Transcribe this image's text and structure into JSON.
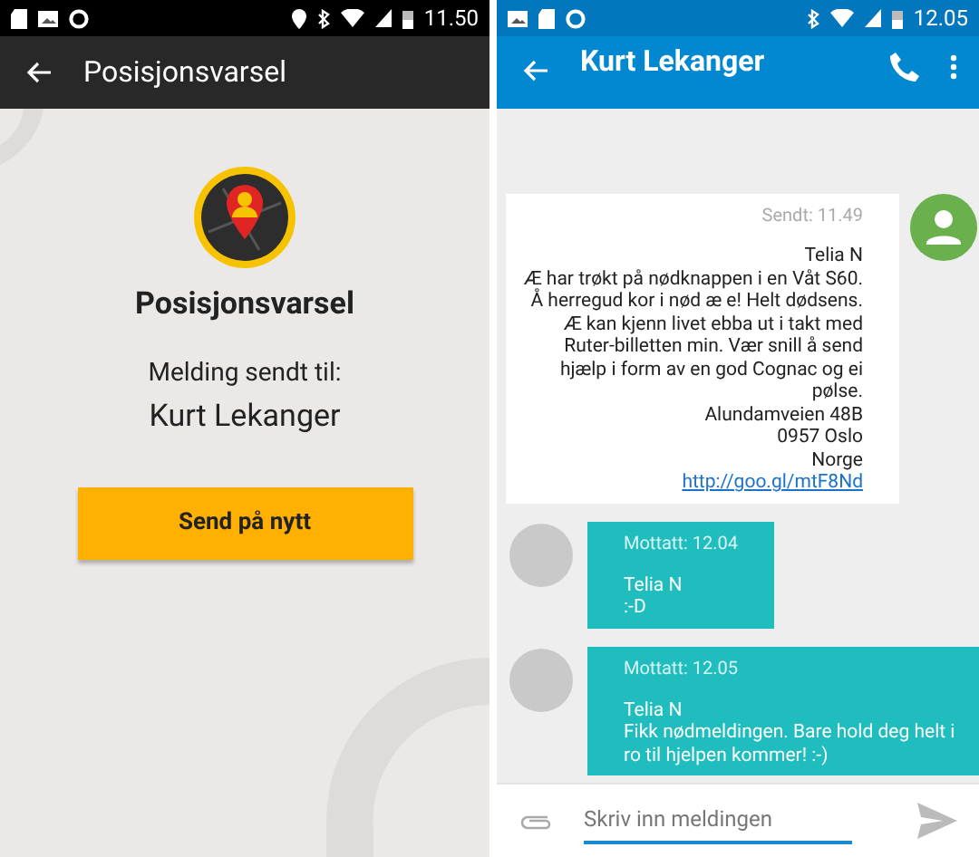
{
  "left": {
    "status_bar": {
      "time": "11.50"
    },
    "app_bar": {
      "title": "Posisjonsvarsel"
    },
    "heading": "Posisjonsvarsel",
    "sent_to_label": "Melding sendt til:",
    "recipient": "Kurt Lekanger",
    "resend_button": "Send på nytt"
  },
  "right": {
    "status_bar": {
      "time": "12.05"
    },
    "app_bar": {
      "title": "Kurt Lekanger"
    },
    "messages": [
      {
        "kind": "sent",
        "time": "Sendt: 11.49",
        "lines": [
          "Telia N",
          "Æ har trøkt på nødknappen i en Våt S60.",
          "Å herregud kor i nød æ e! Helt dødsens.",
          "Æ kan kjenn livet ebba ut i takt med",
          "Ruter-billetten min. Vær snill å send",
          "hjælp i form av en god Cognac og ei",
          "pølse.",
          "Alundamveien 48B",
          "0957 Oslo",
          "Norge"
        ],
        "link": "http://goo.gl/mtF8Nd"
      },
      {
        "kind": "received",
        "time": "Mottatt: 12.04",
        "lines": [
          "Telia N",
          ":-D"
        ]
      },
      {
        "kind": "received",
        "time": "Mottatt: 12.05",
        "lines": [
          "Telia N",
          "Fikk nødmeldingen. Bare hold deg helt i",
          "ro til hjelpen kommer! :-)"
        ]
      }
    ],
    "composer": {
      "placeholder": "Skriv inn meldingen"
    }
  }
}
